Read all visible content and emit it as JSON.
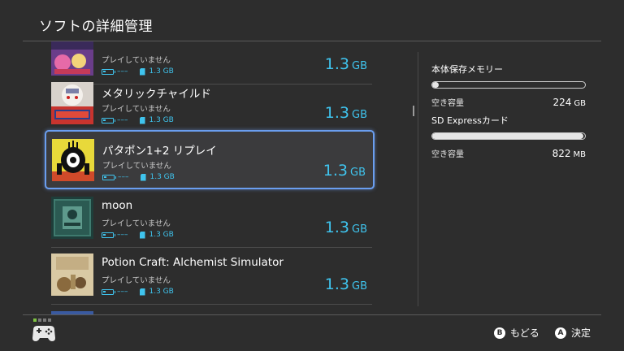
{
  "header": {
    "title": "ソフトの詳細管理"
  },
  "games": [
    {
      "title": "",
      "status": "プレイしていません",
      "battery": "–––",
      "card_size": "1.3 GB",
      "size_value": "1.3",
      "size_unit": "GB"
    },
    {
      "title": "メタリックチャイルド",
      "status": "プレイしていません",
      "battery": "–––",
      "card_size": "1.3 GB",
      "size_value": "1.3",
      "size_unit": "GB"
    },
    {
      "title": "パタポン1+2 リプレイ",
      "status": "プレイしていません",
      "battery": "–––",
      "card_size": "1.3 GB",
      "size_value": "1.3",
      "size_unit": "GB",
      "selected": true
    },
    {
      "title": "moon",
      "status": "プレイしていません",
      "battery": "–––",
      "card_size": "1.3 GB",
      "size_value": "1.3",
      "size_unit": "GB"
    },
    {
      "title": "Potion Craft: Alchemist Simulator",
      "status": "プレイしていません",
      "battery": "–––",
      "card_size": "1.3 GB",
      "size_value": "1.3",
      "size_unit": "GB"
    }
  ],
  "storage": {
    "system": {
      "label": "本体保存メモリー",
      "free_label": "空き容量",
      "free_value": "224",
      "free_unit": "GB",
      "used_fraction": 0.04
    },
    "sd": {
      "label": "SD Expressカード",
      "free_label": "空き容量",
      "free_value": "822",
      "free_unit": "MB",
      "used_fraction": 0.99
    }
  },
  "footer": {
    "back": {
      "button": "B",
      "label": "もどる"
    },
    "confirm": {
      "button": "A",
      "label": "決定"
    }
  },
  "colors": {
    "accent": "#3fc4ee",
    "background": "#2d2d2d",
    "selection_border": "#6a9ef0"
  }
}
